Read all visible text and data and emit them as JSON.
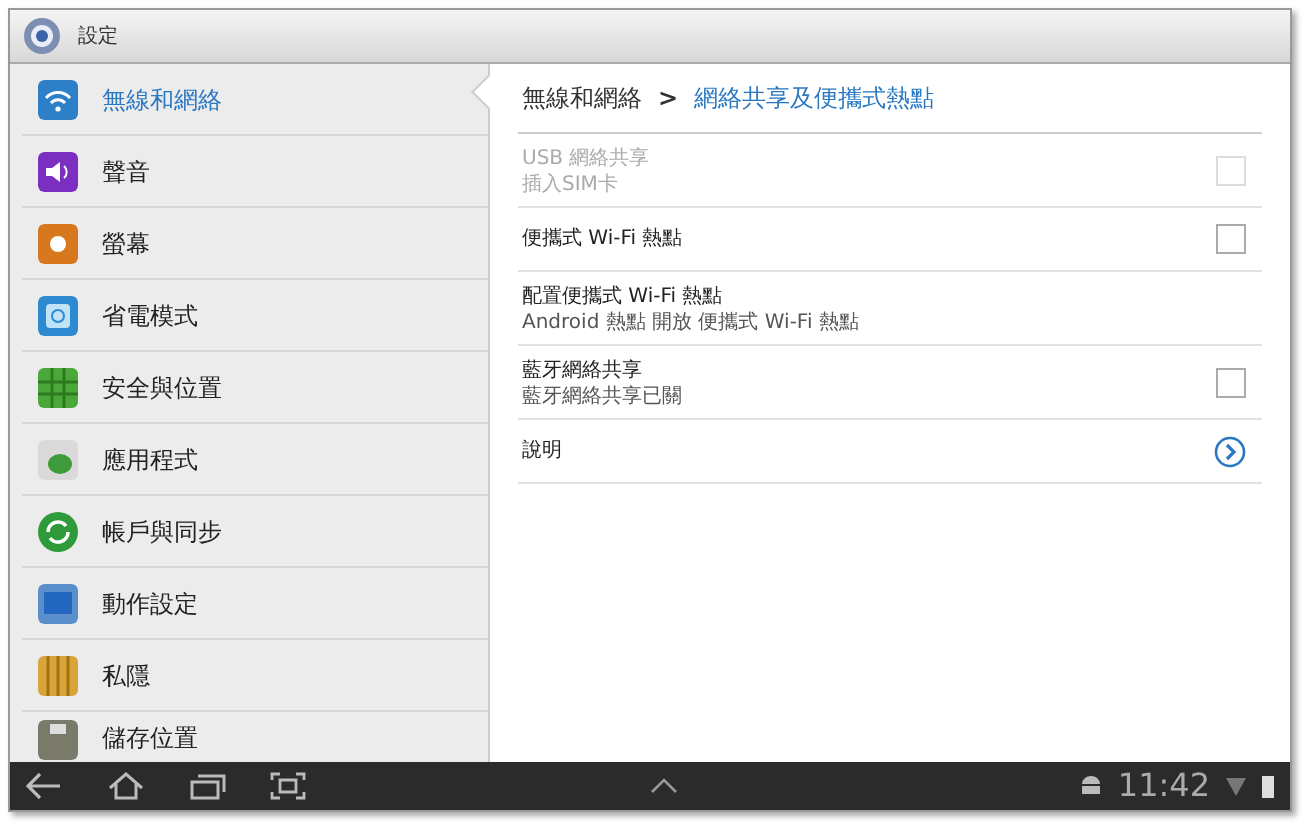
{
  "window": {
    "title": "設定"
  },
  "sidebar": {
    "items": [
      {
        "label": "無線和網絡",
        "selected": true
      },
      {
        "label": "聲音",
        "selected": false
      },
      {
        "label": "螢幕",
        "selected": false
      },
      {
        "label": "省電模式",
        "selected": false
      },
      {
        "label": "安全與位置",
        "selected": false
      },
      {
        "label": "應用程式",
        "selected": false
      },
      {
        "label": "帳戶與同步",
        "selected": false
      },
      {
        "label": "動作設定",
        "selected": false
      },
      {
        "label": "私隱",
        "selected": false
      },
      {
        "label": "儲存位置",
        "selected": false
      }
    ]
  },
  "breadcrumb": {
    "parent": "無線和網絡",
    "separator": ">",
    "current": "網絡共享及便攜式熱點"
  },
  "preferences": [
    {
      "kind": "checkbox",
      "title": "USB 網絡共享",
      "summary": "插入SIM卡",
      "disabled": true,
      "checked": false
    },
    {
      "kind": "checkbox",
      "title": "便攜式 Wi-Fi 熱點",
      "disabled": false,
      "checked": false
    },
    {
      "kind": "text",
      "title": "配置便攜式 Wi-Fi 熱點",
      "summary": "Android 熱點 開放 便攜式 Wi-Fi 熱點",
      "disabled": false
    },
    {
      "kind": "checkbox",
      "title": "藍牙網絡共享",
      "summary": "藍牙網絡共享已關",
      "disabled": false,
      "checked": false
    },
    {
      "kind": "link",
      "title": "說明",
      "disabled": false
    }
  ],
  "status_bar": {
    "time": "11:42"
  }
}
